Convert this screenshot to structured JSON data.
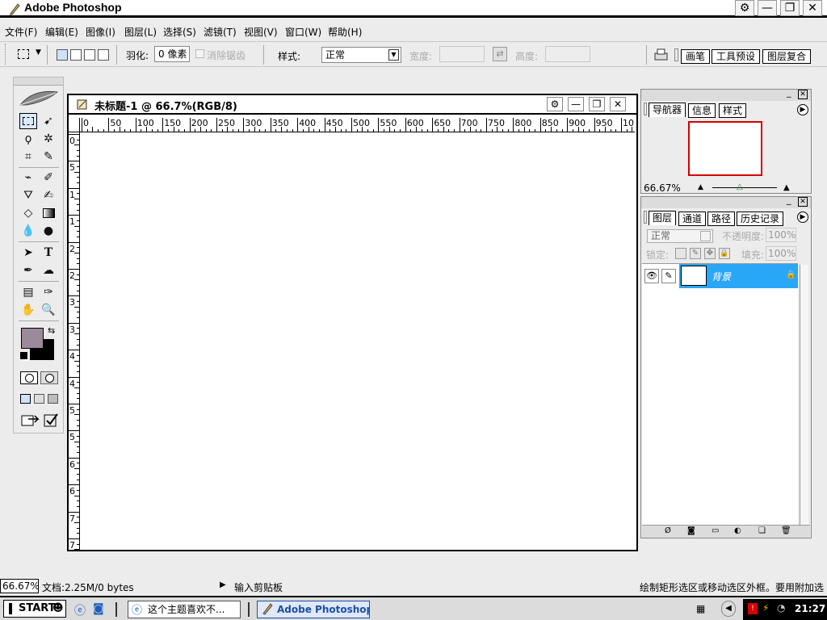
{
  "window": {
    "title": "Adobe Photoshop"
  },
  "menu": [
    "文件(F)",
    "编辑(E)",
    "图像(I)",
    "图层(L)",
    "选择(S)",
    "滤镜(T)",
    "视图(V)",
    "窗口(W)",
    "帮助(H)"
  ],
  "options": {
    "feather_label": "羽化:",
    "feather_value": "0 像素",
    "antialias_label": "消除锯齿",
    "style_label": "样式:",
    "style_value": "正常",
    "width_label": "宽度:",
    "height_label": "高度:"
  },
  "palette_well": [
    "画笔",
    "工具预设",
    "图层复合"
  ],
  "document": {
    "title": "未标题-1 @ 66.7%(RGB/8)",
    "ruler_h": [
      "0",
      "50",
      "100",
      "150",
      "200",
      "250",
      "300",
      "350",
      "400",
      "450",
      "500",
      "550",
      "600",
      "650",
      "700",
      "750",
      "800",
      "850",
      "900",
      "950",
      "10"
    ],
    "ruler_v": [
      "0",
      "5",
      "1",
      "1",
      "2",
      "2",
      "3",
      "3",
      "4",
      "4",
      "5",
      "5",
      "6",
      "6",
      "7",
      "7"
    ]
  },
  "navigator": {
    "tabs": [
      "导航器",
      "信息",
      "样式"
    ],
    "zoom": "66.67%"
  },
  "layers": {
    "tabs": [
      "图层",
      "通道",
      "路径",
      "历史记录"
    ],
    "blend_mode": "正常",
    "opacity_label": "不透明度:",
    "opacity_value": "100%",
    "lock_label": "锁定:",
    "fill_label": "填充:",
    "fill_value": "100%",
    "items": [
      {
        "name": "背景"
      }
    ]
  },
  "status": {
    "zoom": "66.67%",
    "doc_info": "文档:2.25M/0 bytes",
    "clipboard": "输入剪贴板",
    "hint": "绘制矩形选区或移动选区外框。要用附加选"
  },
  "taskbar": {
    "start": "START",
    "tasks": [
      "这个主题喜欢不...",
      "Adobe Photoshop"
    ],
    "clock": "21:27"
  },
  "colors": {
    "selection_blue": "#2aa6f7",
    "foreground_swatch": "#9b8a9a",
    "background_swatch": "#000000",
    "nav_frame_red": "#d40000"
  }
}
